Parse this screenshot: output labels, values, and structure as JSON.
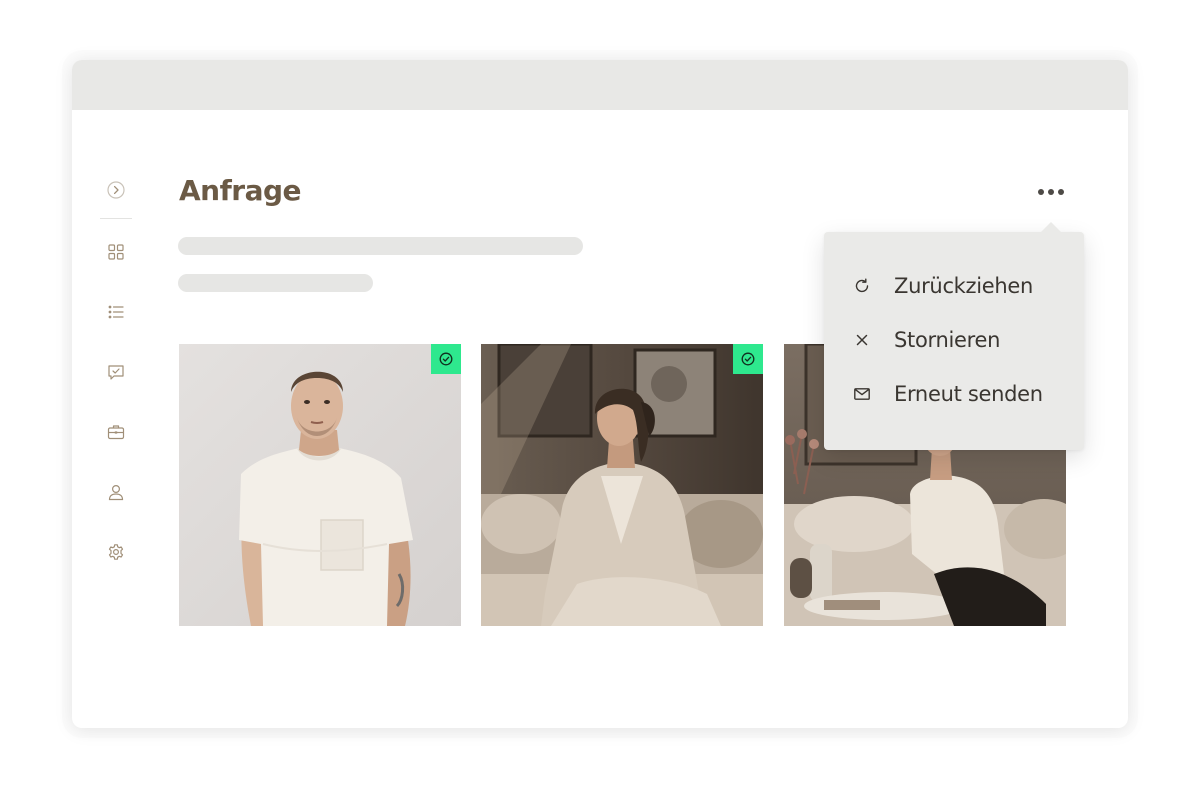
{
  "page": {
    "title": "Anfrage"
  },
  "sidebar": {
    "items": [
      {
        "name": "expand",
        "icon": "chevron-right-circle-icon"
      },
      {
        "name": "dashboard",
        "icon": "grid-icon"
      },
      {
        "name": "list",
        "icon": "list-icon"
      },
      {
        "name": "messages",
        "icon": "message-check-icon"
      },
      {
        "name": "jobs",
        "icon": "briefcase-icon"
      },
      {
        "name": "profile",
        "icon": "user-icon"
      },
      {
        "name": "settings",
        "icon": "gear-icon"
      }
    ]
  },
  "header": {
    "more_icon": "more-horizontal-icon"
  },
  "menu": {
    "items": [
      {
        "label": "Zurückziehen",
        "icon": "refresh-icon"
      },
      {
        "label": "Stornieren",
        "icon": "close-icon"
      },
      {
        "label": "Erneut senden",
        "icon": "mail-icon"
      }
    ]
  },
  "gallery": {
    "photos": [
      {
        "subject": "man in white t-shirt",
        "selected": true
      },
      {
        "subject": "woman in beige cardigan on sofa",
        "selected": true
      },
      {
        "subject": "woman in knit sweater on sofa",
        "selected": false
      }
    ]
  },
  "colors": {
    "title": "#6b5a45",
    "icon": "#a08f78",
    "accent_check": "#2ee88e",
    "titlebar": "#e8e8e6",
    "menu_bg": "#eaeae8",
    "skeleton": "#e6e6e4"
  }
}
